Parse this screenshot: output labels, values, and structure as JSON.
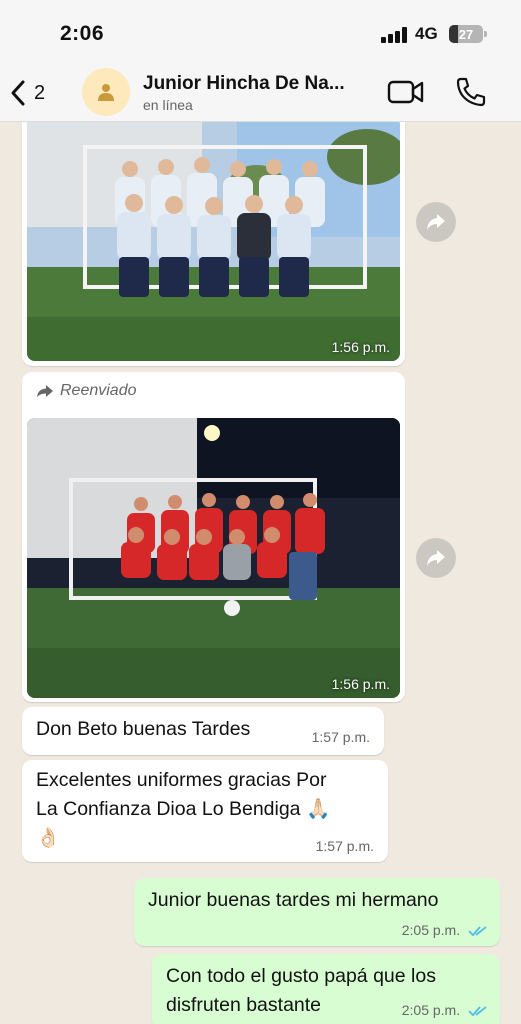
{
  "status_bar": {
    "time": "2:06",
    "network": "4G",
    "battery_level": "27",
    "battery_fraction": 0.27
  },
  "header": {
    "back_count": "2",
    "contact_name": "Junior Hincha De Na...",
    "contact_status": "en línea",
    "icons": [
      "chevron-left-icon",
      "person-icon",
      "video-camera-icon",
      "phone-icon"
    ]
  },
  "messages": [
    {
      "type": "image",
      "direction": "in",
      "time": "1:56 p.m.",
      "icon": "share-forward-icon"
    },
    {
      "type": "image",
      "direction": "in",
      "forwarded_label": "Reenviado",
      "time": "1:56 p.m.",
      "icon": "share-forward-icon"
    },
    {
      "type": "text",
      "direction": "in",
      "text": "Don Beto buenas Tardes",
      "time": "1:57 p.m."
    },
    {
      "type": "text",
      "direction": "in",
      "line1": "Excelentes uniformes gracias Por",
      "line2": "La Confianza Dioa Lo Bendiga",
      "emoji1": "🙏🏻",
      "emoji2": "👌🏻",
      "time": "1:57 p.m."
    },
    {
      "type": "text",
      "direction": "out",
      "text": "Junior buenas tardes mi hermano",
      "time": "2:05 p.m.",
      "status": "read"
    },
    {
      "type": "text",
      "direction": "out",
      "line1": "Con todo el gusto papá que los",
      "line2": "disfruten bastante",
      "time": "2:05 p.m.",
      "status": "read"
    }
  ],
  "colors": {
    "chat_background": "#efe9df",
    "incoming_bubble": "#ffffff",
    "outgoing_bubble": "#d9fdd3",
    "read_ticks": "#53bdeb"
  }
}
